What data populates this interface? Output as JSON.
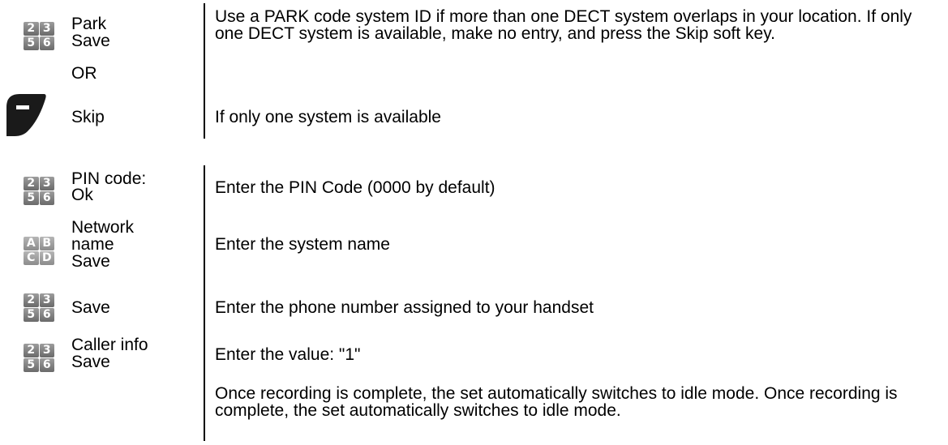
{
  "rows": [
    {
      "icon": "keypad-digits-icon",
      "keys": [
        "2",
        "3",
        "5",
        "6"
      ],
      "label_lines": [
        "Park",
        "Save"
      ],
      "description": "Use a PARK code system ID if more than one DECT system overlaps in your location. If only one DECT system is available, make no entry, and press the Skip soft key."
    },
    {
      "label": "OR"
    },
    {
      "icon": "soft-key-icon",
      "label": "Skip",
      "description": "If only one system is available"
    },
    {
      "icon": "keypad-digits-icon",
      "keys": [
        "2",
        "3",
        "5",
        "6"
      ],
      "label_lines": [
        "PIN code:",
        "Ok"
      ],
      "description": "Enter the PIN Code (0000 by default)"
    },
    {
      "icon": "keypad-letters-icon",
      "keys": [
        "A",
        "B",
        "C",
        "D"
      ],
      "label_lines": [
        "Network",
        "name",
        "Save"
      ],
      "description": "Enter the system name"
    },
    {
      "icon": "keypad-digits-icon",
      "keys": [
        "2",
        "3",
        "5",
        "6"
      ],
      "label": "Save",
      "description": "Enter the phone number assigned to your handset"
    },
    {
      "icon": "keypad-digits-icon",
      "keys": [
        "2",
        "3",
        "5",
        "6"
      ],
      "label_lines": [
        "Caller info",
        "Save"
      ],
      "description": "Enter the value: \"1\""
    },
    {
      "description": "Once recording is complete, the set automatically switches to idle mode. Once recording is complete, the set automatically switches to idle mode."
    }
  ]
}
